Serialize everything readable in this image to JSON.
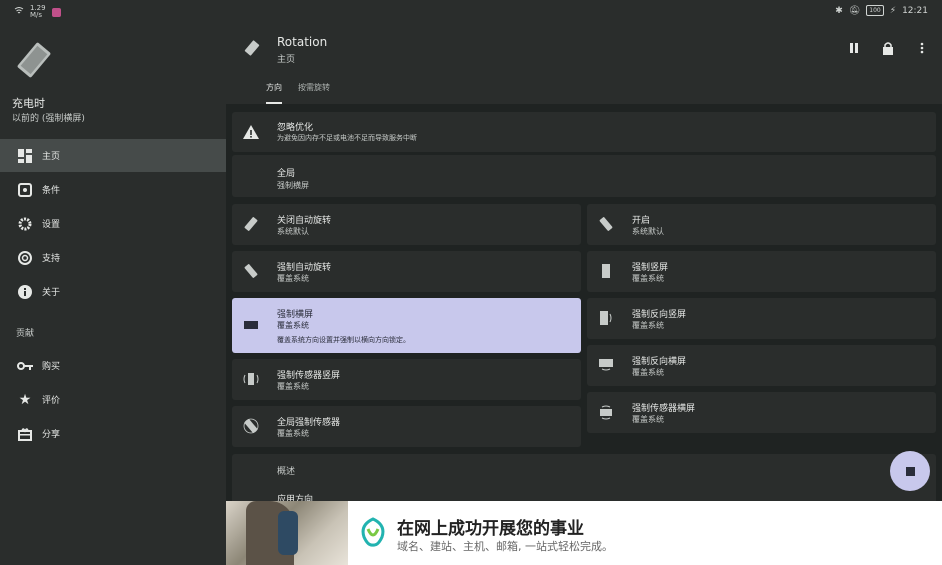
{
  "status_bar": {
    "net_speed": "1.29\nM/s",
    "battery": "100",
    "time": "12:21"
  },
  "sidebar": {
    "title": "充电时",
    "subtitle": "以前的 (强制横屏)",
    "items": [
      {
        "label": "主页",
        "icon": "dashboard-icon"
      },
      {
        "label": "条件",
        "icon": "conditions-icon"
      },
      {
        "label": "设置",
        "icon": "gear-icon"
      },
      {
        "label": "支持",
        "icon": "support-icon"
      },
      {
        "label": "关于",
        "icon": "info-icon"
      }
    ],
    "section_label": "贡献",
    "contrib_items": [
      {
        "label": "购买",
        "icon": "key-icon"
      },
      {
        "label": "评价",
        "icon": "star-icon"
      },
      {
        "label": "分享",
        "icon": "gift-icon"
      }
    ]
  },
  "header": {
    "title": "Rotation",
    "subtitle": "主页",
    "tabs": [
      "方向",
      "按需旋转"
    ]
  },
  "warning": {
    "title": "忽略优化",
    "desc": "为避免因内存不足或电池不足而导致服务中断"
  },
  "global": {
    "title": "全局",
    "subtitle": "强制横屏"
  },
  "left_modes": [
    {
      "title": "关闭自动旋转",
      "sub": "系统默认"
    },
    {
      "title": "强制自动旋转",
      "sub": "覆盖系统"
    },
    {
      "title": "强制横屏",
      "sub": "覆盖系统",
      "desc": "覆盖系统方向设置并强制以横向方向锁定。"
    },
    {
      "title": "强制传感器竖屏",
      "sub": "覆盖系统"
    },
    {
      "title": "全局强制传感器",
      "sub": "覆盖系统"
    }
  ],
  "right_modes": [
    {
      "title": "开启",
      "sub": "系统默认"
    },
    {
      "title": "强制竖屏",
      "sub": "覆盖系统"
    },
    {
      "title": "强制反向竖屏",
      "sub": "覆盖系统"
    },
    {
      "title": "强制反向横屏",
      "sub": "覆盖系统"
    },
    {
      "title": "强制传感器横屏",
      "sub": "覆盖系统"
    }
  ],
  "overview": {
    "title": "概述",
    "item": "应用方向"
  },
  "ad": {
    "title": "在网上成功开展您的事业",
    "subtitle": "域名、建站、主机、邮箱, 一站式轻松完成。"
  },
  "colors": {
    "background": "#1f2322",
    "surface": "#2a2d2c",
    "selected": "#c8c8ec",
    "nav_active": "#464b4a"
  }
}
